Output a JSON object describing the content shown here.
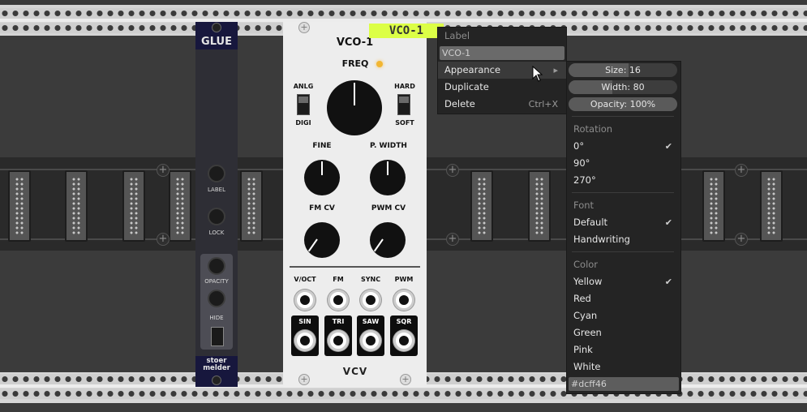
{
  "rack": {
    "brand_logo": "VCV"
  },
  "glue_module": {
    "title": "GLUE",
    "labels": {
      "label": "LABEL",
      "lock": "LOCK",
      "opacity": "OPACITY",
      "hide": "HIDE"
    },
    "brand": "stoer\nmelder"
  },
  "vco_module": {
    "title": "VCO-1",
    "freq_label": "FREQ",
    "anlg": "ANLG",
    "digi": "DIGI",
    "hard": "HARD",
    "soft": "SOFT",
    "fine": "FINE",
    "pwidth": "P. WIDTH",
    "fmcv": "FM CV",
    "pwmcv": "PWM CV",
    "inputs": [
      "V/OCT",
      "FM",
      "SYNC",
      "PWM"
    ],
    "outputs": [
      "SIN",
      "TRI",
      "SAW",
      "SQR"
    ],
    "logo": "VCV"
  },
  "label_tag": {
    "text": "VCO-1",
    "color": "#dcff46"
  },
  "context_menu": {
    "header": "Label",
    "label_value": "VCO-1",
    "appearance": "Appearance",
    "appearance_arrow": "▸",
    "duplicate": "Duplicate",
    "delete": "Delete",
    "delete_shortcut": "Ctrl+X"
  },
  "appearance_menu": {
    "size": {
      "text": "Size: 16",
      "level": 0.55
    },
    "width": {
      "text": "Width: 80",
      "level": 0.4
    },
    "opacity": {
      "text": "Opacity: 100%",
      "level": 1.0
    },
    "rotation_header": "Rotation",
    "rotations": [
      {
        "label": "0°",
        "checked": "✔"
      },
      {
        "label": "90°",
        "checked": ""
      },
      {
        "label": "270°",
        "checked": ""
      }
    ],
    "font_header": "Font",
    "fonts": [
      {
        "label": "Default",
        "checked": "✔"
      },
      {
        "label": "Handwriting",
        "checked": ""
      }
    ],
    "color_header": "Color",
    "colors": [
      {
        "label": "Yellow",
        "checked": "✔"
      },
      {
        "label": "Red",
        "checked": ""
      },
      {
        "label": "Cyan",
        "checked": ""
      },
      {
        "label": "Green",
        "checked": ""
      },
      {
        "label": "Pink",
        "checked": ""
      },
      {
        "label": "White",
        "checked": ""
      }
    ],
    "hex_value": "#dcff46"
  }
}
